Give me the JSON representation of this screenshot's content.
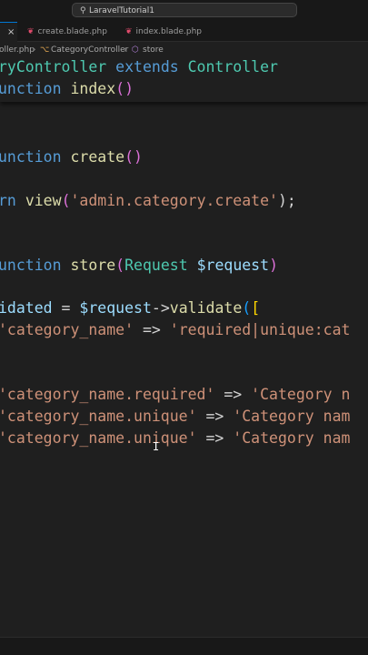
{
  "window": {
    "search_text": "LaravelTutorial1",
    "search_icon": "search-icon"
  },
  "tabs": [
    {
      "label": "",
      "active": true,
      "close": "×"
    },
    {
      "label": "create.blade.php",
      "icon": "php-icon"
    },
    {
      "label": "index.blade.php",
      "icon": "php-icon"
    }
  ],
  "breadcrumb": {
    "file": "oller.php",
    "class": "CategoryController",
    "method": "store",
    "separator": "›"
  },
  "code": {
    "sticky_line1": {
      "a": "ryController",
      "b": " extends ",
      "c": "Controller"
    },
    "sticky_line2": {
      "a": "unction",
      "b": "index",
      "c": "()"
    },
    "create_line": {
      "a": "unction",
      "b": "create",
      "c": "()"
    },
    "return_line": {
      "a": "rn",
      "b": "view",
      "c": "(",
      "d": "'admin.category.create'",
      "e": ");"
    },
    "store_line": {
      "a": "unction",
      "b": "store",
      "c": "(",
      "d": "Request",
      "e": "$request",
      "f": ")"
    },
    "validate_line": {
      "a": "idated",
      "b": " = ",
      "c": "$request",
      "d": "->",
      "e": "validate",
      "f": "(",
      "g": "["
    },
    "rule_line": {
      "a": "'category_name'",
      "b": " => ",
      "c": "'required|unique:cat"
    },
    "msg_line1": {
      "a": "'category_name.required'",
      "b": " => ",
      "c": "'Category n"
    },
    "msg_line2": {
      "a": "'category_name.unique'",
      "b": " => ",
      "c": "'Category nam"
    },
    "msg_line3": {
      "a": "'category_name.unique'",
      "b": " => ",
      "c": "'Category nam"
    }
  }
}
